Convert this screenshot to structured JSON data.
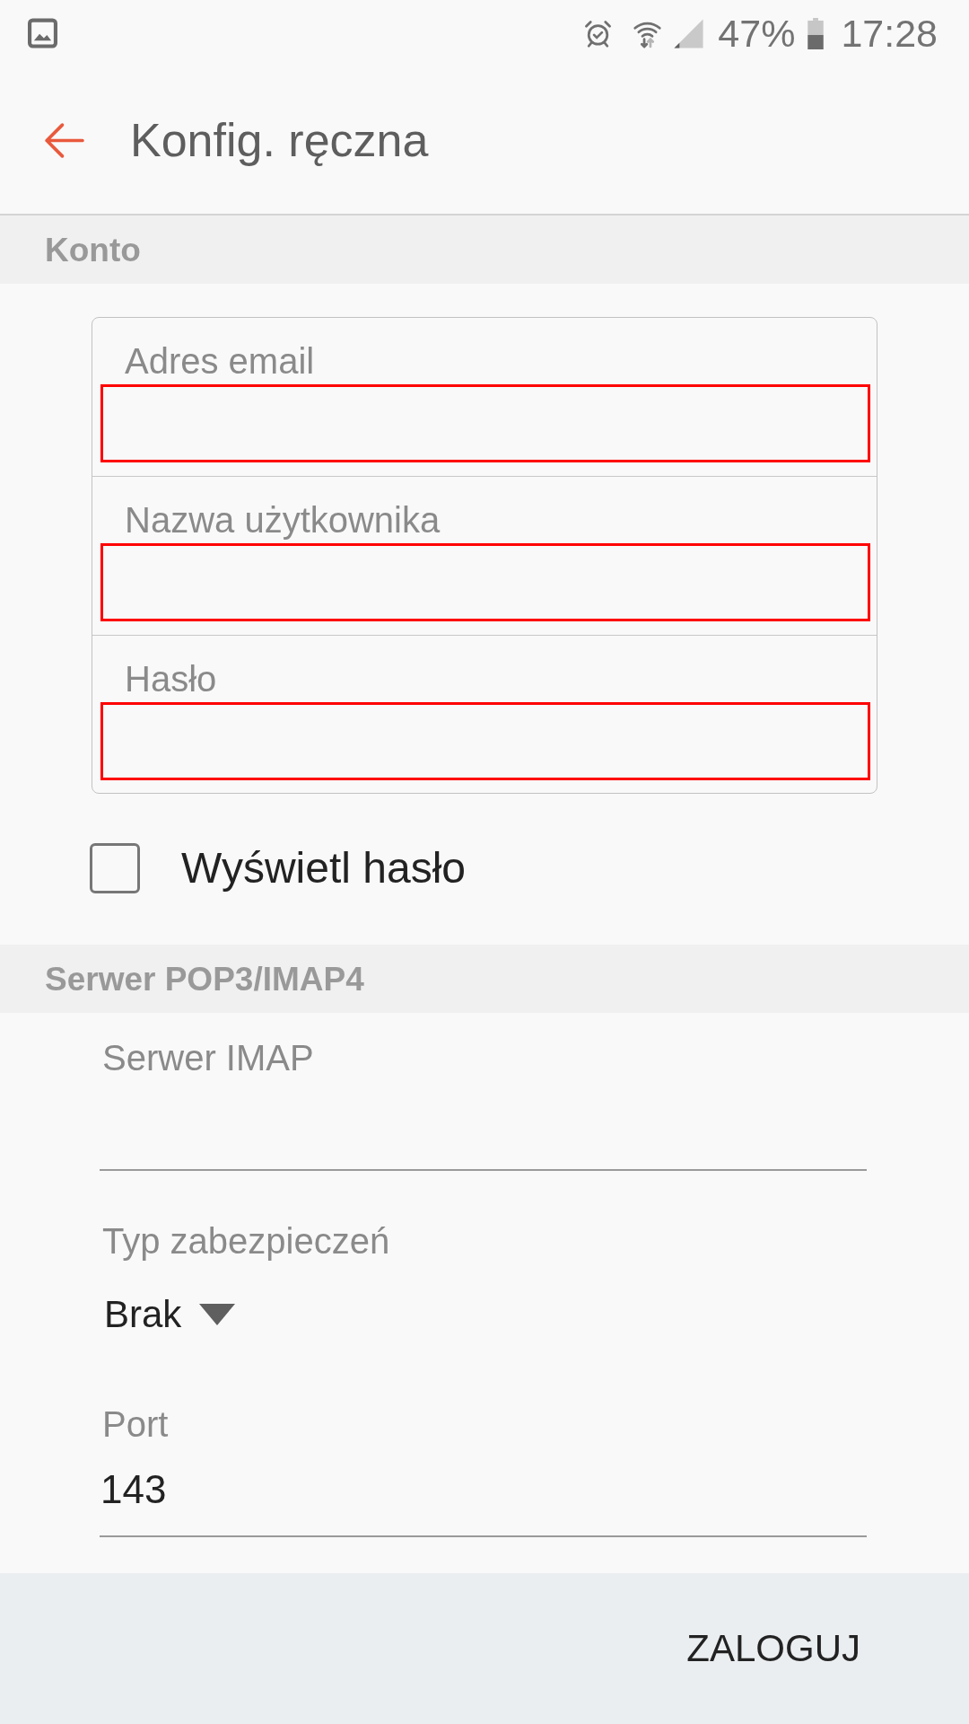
{
  "status_bar": {
    "battery": "47%",
    "time": "17:28"
  },
  "header": {
    "title": "Konfig. ręczna"
  },
  "account": {
    "title": "Konto",
    "fields": [
      {
        "label": "Adres email"
      },
      {
        "label": "Nazwa użytkownika"
      },
      {
        "label": "Hasło"
      }
    ],
    "show_password": {
      "label": "Wyświetl hasło",
      "checked": false
    }
  },
  "server": {
    "title": "Serwer POP3/IMAP4",
    "fields": [
      {
        "kind": "text",
        "label": "Serwer IMAP"
      },
      {
        "kind": "dropdown",
        "label": "Typ zabezpieczeń",
        "value": "Brak"
      },
      {
        "kind": "text",
        "label": "Port",
        "value": "143"
      }
    ]
  },
  "footer": {
    "button": "ZALOGUJ"
  }
}
